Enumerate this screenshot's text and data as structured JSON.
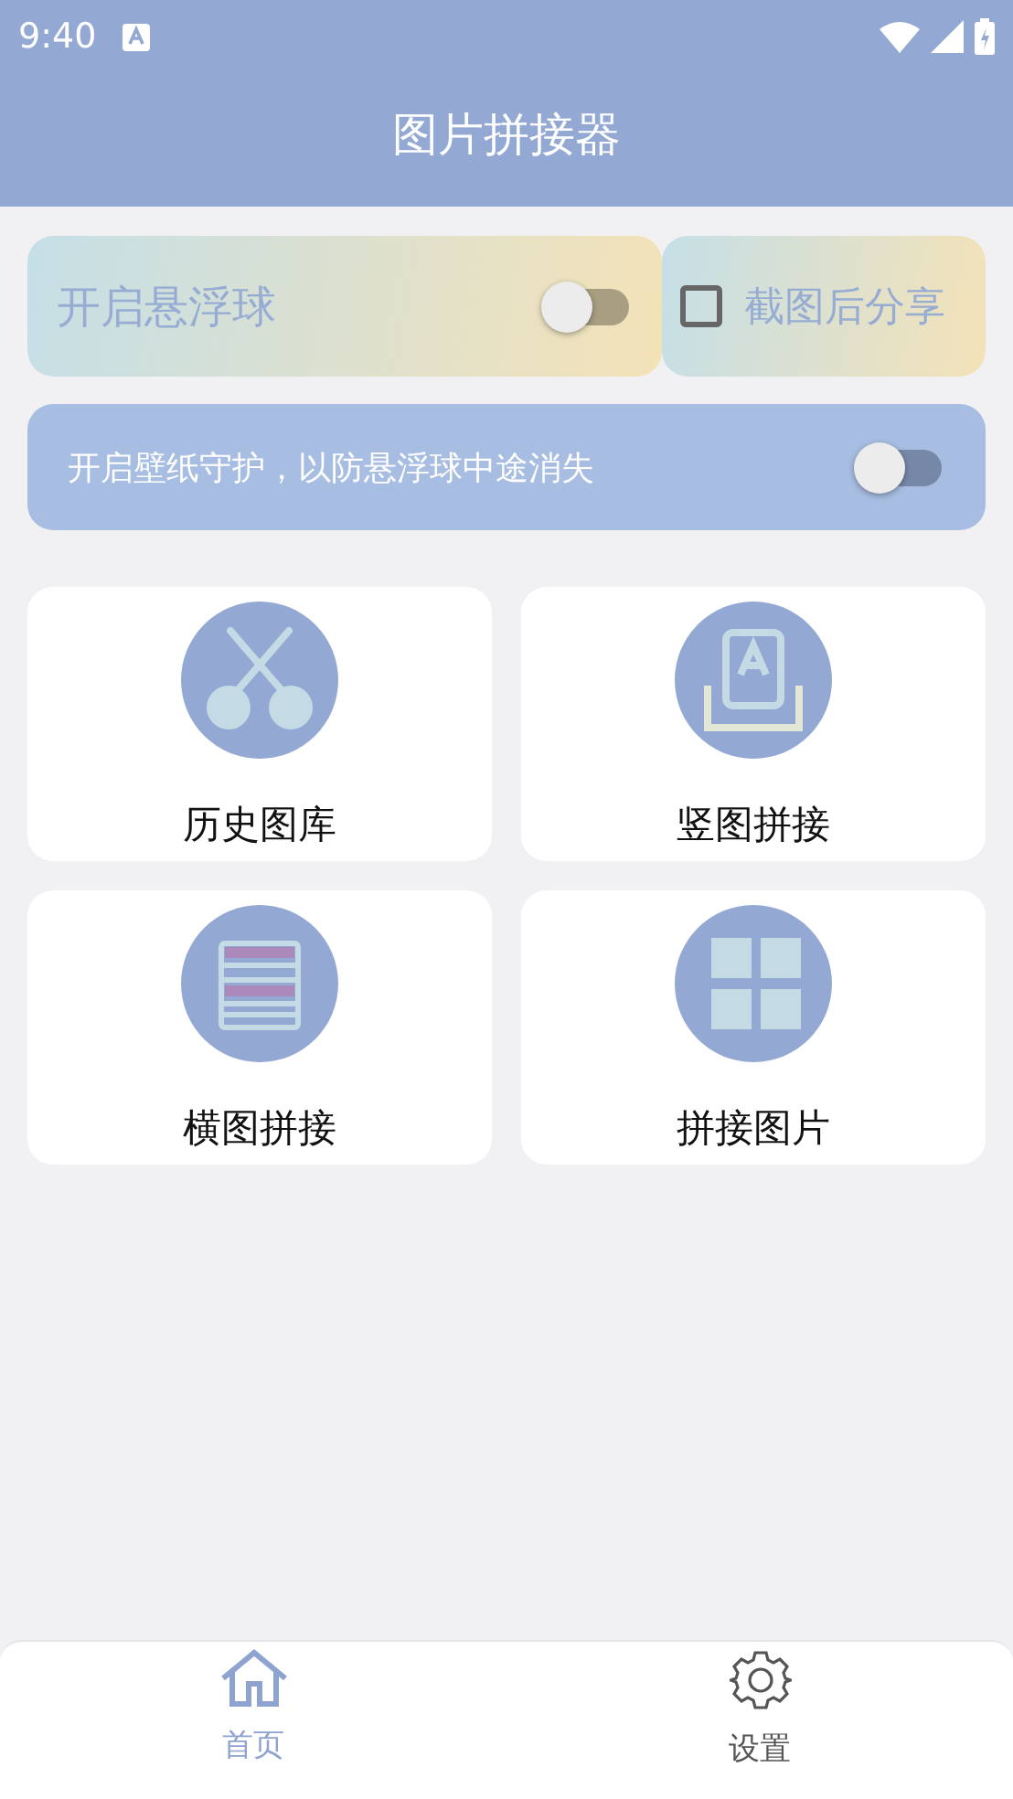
{
  "status_bar": {
    "time": "9:40"
  },
  "app_bar": {
    "title": "图片拼接器"
  },
  "float_ball": {
    "label": "开启悬浮球",
    "on": false
  },
  "share_option": {
    "label": "截图后分享",
    "checked": false
  },
  "wallpaper_guard": {
    "label": "开启壁纸守护，以防悬浮球中途消失",
    "on": false
  },
  "tiles": [
    {
      "label": "历史图库",
      "kind": "scissors"
    },
    {
      "label": "竖图拼接",
      "kind": "portrait"
    },
    {
      "label": "横图拼接",
      "kind": "rows"
    },
    {
      "label": "拼接图片",
      "kind": "grid"
    }
  ],
  "bottom_nav": [
    {
      "label": "首页",
      "kind": "home",
      "selected": true
    },
    {
      "label": "设置",
      "kind": "settings",
      "selected": false
    }
  ]
}
